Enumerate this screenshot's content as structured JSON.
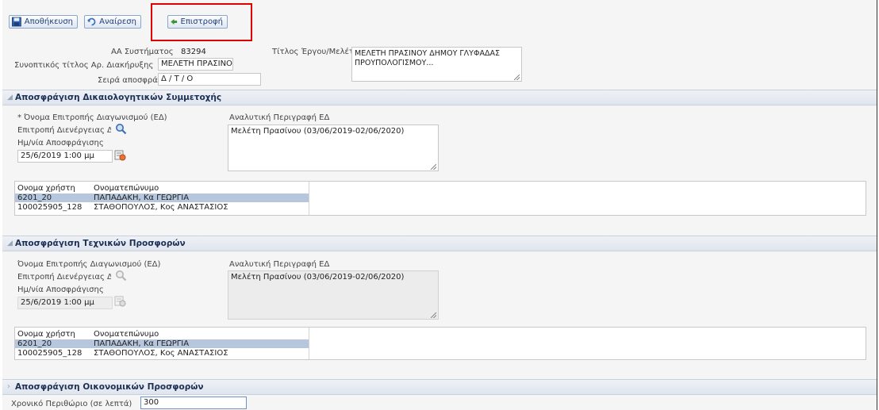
{
  "toolbar": {
    "save_label": "Αποθήκευση",
    "undo_label": "Αναίρεση",
    "back_label": "Επιστροφή"
  },
  "header": {
    "system_id_label": "ΑΑ Συστήματος",
    "system_id_value": "83294",
    "short_title_label": "Συνοπτικός τίτλος Αρ. Διακήρυξης",
    "short_title_value": "ΜΕΛΕΤΗ ΠΡΑΣΙΝΟΥ",
    "order_label": "Σειρά αποσφράγισης",
    "order_value": "Δ / Τ / Ο",
    "project_title_label": "Τίτλος Έργου/Μελέτης",
    "project_title_value": "ΜΕΛΕΤΗ ΠΡΑΣΙΝΟΥ ΔΗΜΟΥ ΓΛΥΦΑΔΑΣ ΠΡΟΥΠΟΛΟΓΙΣΜΟΥ..."
  },
  "section1": {
    "title": "Αποσφράγιση Δικαιολογητικών Συμμετοχής",
    "committee_label": "* Όνομα Επιτροπής Διαγωνισμού (ΕΔ)",
    "committee_value": "Επιτροπή Διενέργειας Διαγωνισμού",
    "datetime_label": "Ημ/νία Αποσφράγισης",
    "datetime_value": "25/6/2019 1:00 μμ",
    "description_label": "Αναλυτική Περιγραφή ΕΔ",
    "description_value": "Μελέτη Πρασίνου (03/06/2019-02/06/2020)",
    "table_headers": [
      "Ονομα χρήστη",
      "Ονοματεπώνυμο"
    ],
    "table_rows": [
      [
        "6201_20",
        "ΠΑΠΑΔΑΚΗ, Κα ΓΕΩΡΓΙΑ"
      ],
      [
        "100025905_128",
        "ΣΤΑΘΟΠΟΥΛΟΣ, Κος ΑΝΑΣΤΑΣΙΟΣ"
      ]
    ]
  },
  "section2": {
    "title": "Αποσφράγιση Τεχνικών Προσφορών",
    "committee_label": "Όνομα Επιτροπής Διαγωνισμού (ΕΔ)",
    "committee_value": "Επιτροπή Διενέργειας Διαγωνισμού",
    "datetime_label": "Ημ/νία Αποσφράγισης",
    "datetime_value": "25/6/2019 1:00 μμ",
    "description_label": "Αναλυτική Περιγραφή ΕΔ",
    "description_value": "Μελέτη Πρασίνου (03/06/2019-02/06/2020)",
    "table_headers": [
      "Ονομα χρήστη",
      "Ονοματεπώνυμο"
    ],
    "table_rows": [
      [
        "6201_20",
        "ΠΑΠΑΔΑΚΗ, Κα ΓΕΩΡΓΙΑ"
      ],
      [
        "100025905_128",
        "ΣΤΑΘΟΠΟΥΛΟΣ, Κος ΑΝΑΣΤΑΣΙΟΣ"
      ]
    ]
  },
  "section3": {
    "title": "Αποσφράγιση Οικονομικών Προσφορών",
    "margin_label": "Χρονικό Περιθώριο (σε λεπτά)",
    "margin_value": "300"
  }
}
